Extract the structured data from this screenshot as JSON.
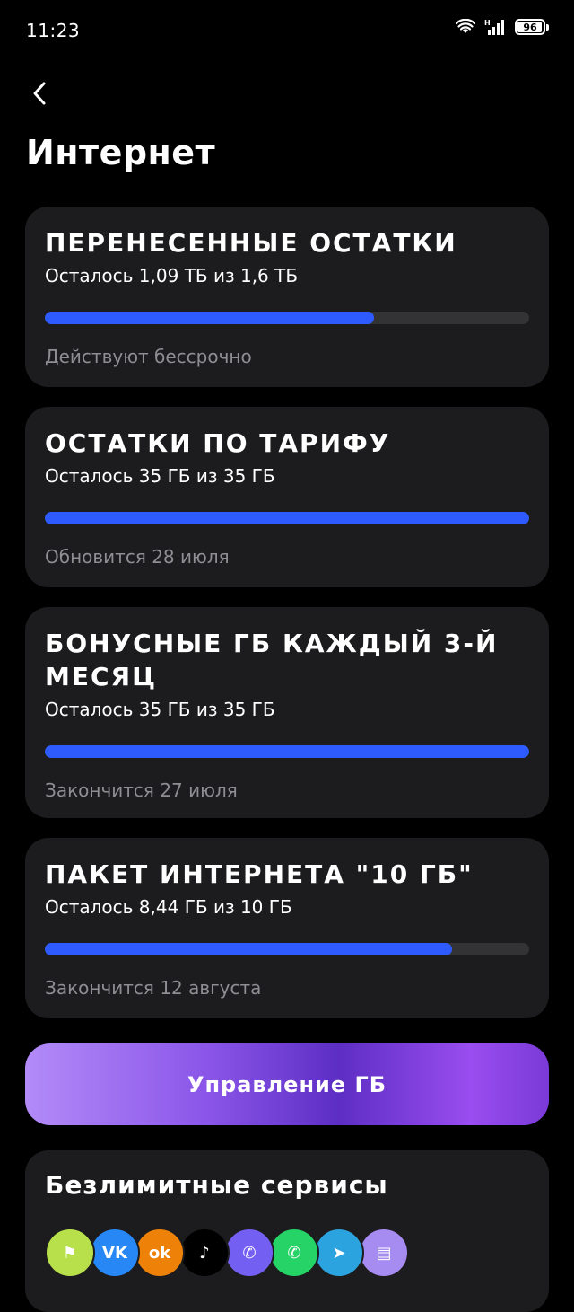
{
  "status_bar": {
    "time": "11:23",
    "battery": "96",
    "battery_level": 0.96
  },
  "page": {
    "title": "Интернет"
  },
  "cards": [
    {
      "title": "ПЕРЕНЕСЕННЫЕ ОСТАТКИ",
      "remaining": "Осталось 1,09 ТБ из 1,6 ТБ",
      "fraction": 0.68,
      "note": "Действуют бессрочно"
    },
    {
      "title": "ОСТАТКИ ПО ТАРИФУ",
      "remaining": "Осталось 35 ГБ из 35 ГБ",
      "fraction": 1.0,
      "note": "Обновится 28 июля"
    },
    {
      "title": "БОНУСНЫЕ ГБ КАЖДЫЙ 3-Й МЕСЯЦ",
      "remaining": "Осталось 35 ГБ из 35 ГБ",
      "fraction": 1.0,
      "note": "Закончится 27 июля"
    },
    {
      "title": "ПАКЕТ ИНТЕРНЕТА \"10 ГБ\"",
      "remaining": "Осталось 8,44 ГБ из 10 ГБ",
      "fraction": 0.84,
      "note": "Закончится 12 августа"
    }
  ],
  "manage_button": {
    "label": "Управление ГБ"
  },
  "services": {
    "title": "Безлимитные сервисы",
    "icons": [
      {
        "name": "signpost-icon",
        "color": "#b8e04a",
        "glyph": "⚑"
      },
      {
        "name": "vk-icon",
        "color": "#2787f5",
        "glyph": "VK"
      },
      {
        "name": "odnoklassniki-icon",
        "color": "#ee8208",
        "glyph": "ok"
      },
      {
        "name": "tiktok-icon",
        "color": "#000000",
        "glyph": "♪"
      },
      {
        "name": "viber-icon",
        "color": "#7360f2",
        "glyph": "✆"
      },
      {
        "name": "whatsapp-icon",
        "color": "#25d366",
        "glyph": "✆"
      },
      {
        "name": "telegram-icon",
        "color": "#2aa3df",
        "glyph": "➤"
      },
      {
        "name": "tv-schedule-icon",
        "color": "#a68bf0",
        "glyph": "▤"
      }
    ]
  },
  "colors": {
    "accent": "#2e5bff",
    "card_bg": "#1c1c1e",
    "track": "#333336",
    "muted": "#8e8e93"
  }
}
